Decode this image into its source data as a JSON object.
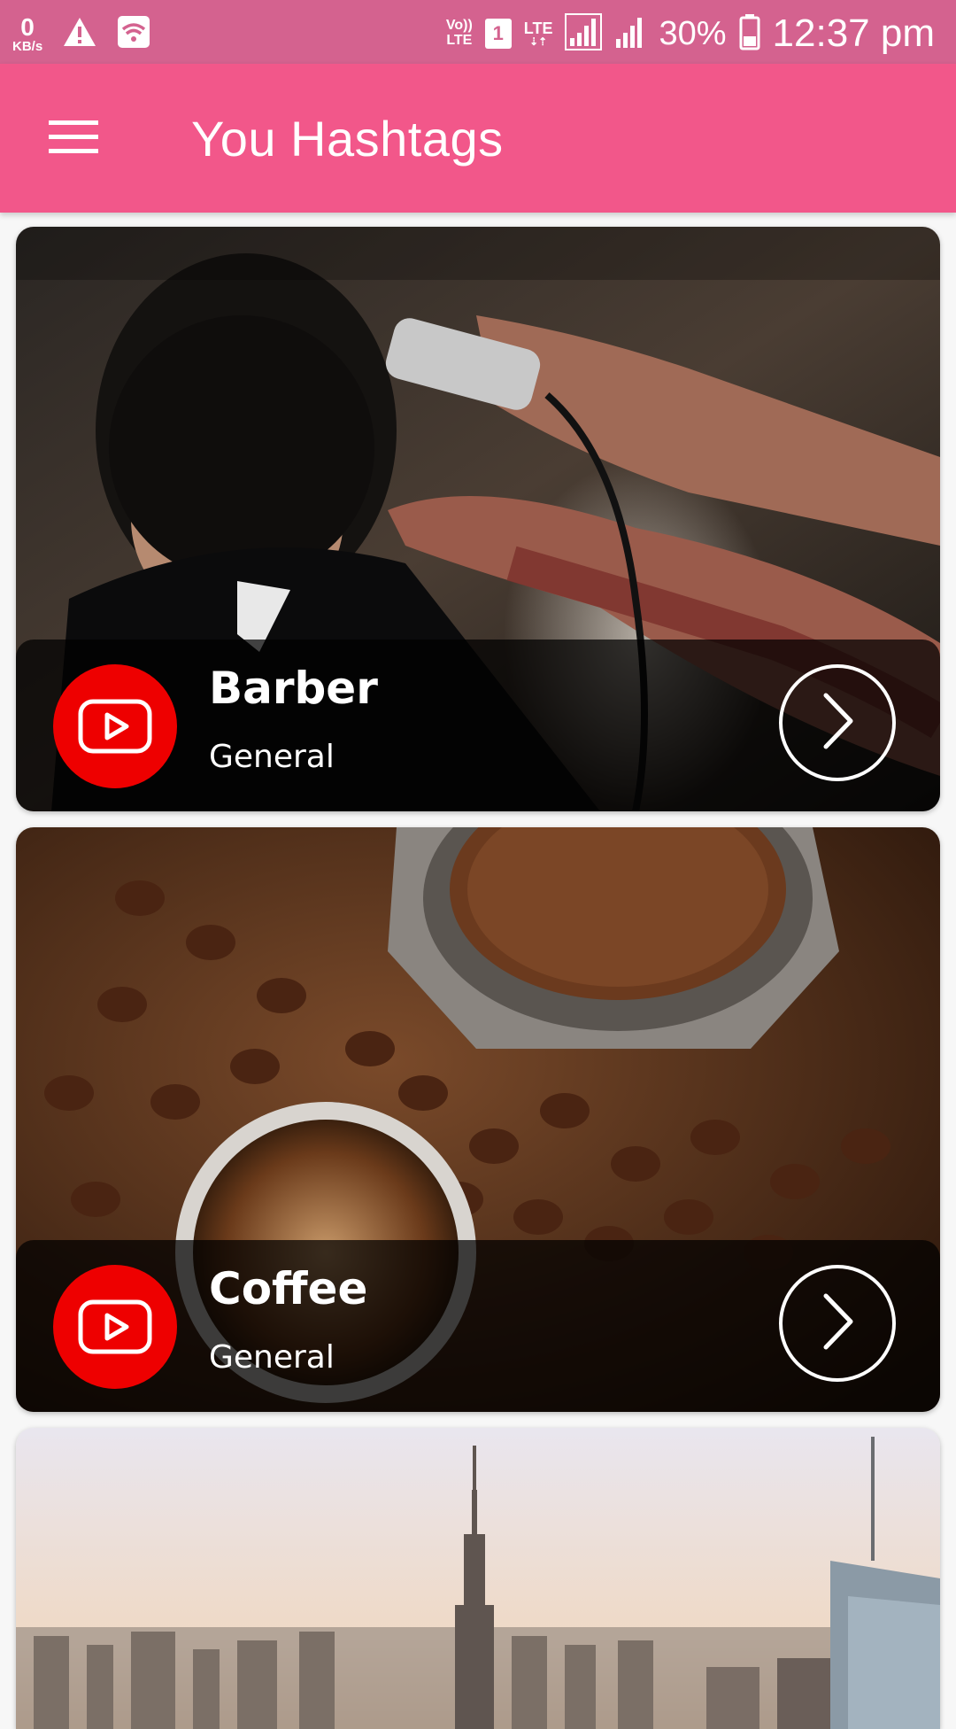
{
  "status_bar": {
    "net_speed_value": "0",
    "net_speed_unit": "KB/s",
    "volte_top": "Vo))",
    "volte_bottom": "LTE",
    "sim_slot": "1",
    "lte_label": "LTE",
    "battery_percent": "30%",
    "time": "12:37 pm",
    "icons": [
      "warning-icon",
      "wifi-icon",
      "signal-icon",
      "signal-icon",
      "battery-icon"
    ]
  },
  "app_bar": {
    "title": "You Hashtags",
    "menu_icon": "hamburger-menu-icon",
    "color": "#f2578a"
  },
  "cards": [
    {
      "title": "Barber",
      "subtitle": "General",
      "badge_icon": "youtube-play-icon",
      "action_icon": "chevron-right-icon",
      "image": "barber-haircut-photo"
    },
    {
      "title": "Coffee",
      "subtitle": "General",
      "badge_icon": "youtube-play-icon",
      "action_icon": "chevron-right-icon",
      "image": "coffee-beans-photo"
    },
    {
      "image": "city-skyline-photo"
    }
  ],
  "colors": {
    "status_bar": "#d4628f",
    "accent": "#f2578a",
    "youtube_red": "#ee0000"
  }
}
